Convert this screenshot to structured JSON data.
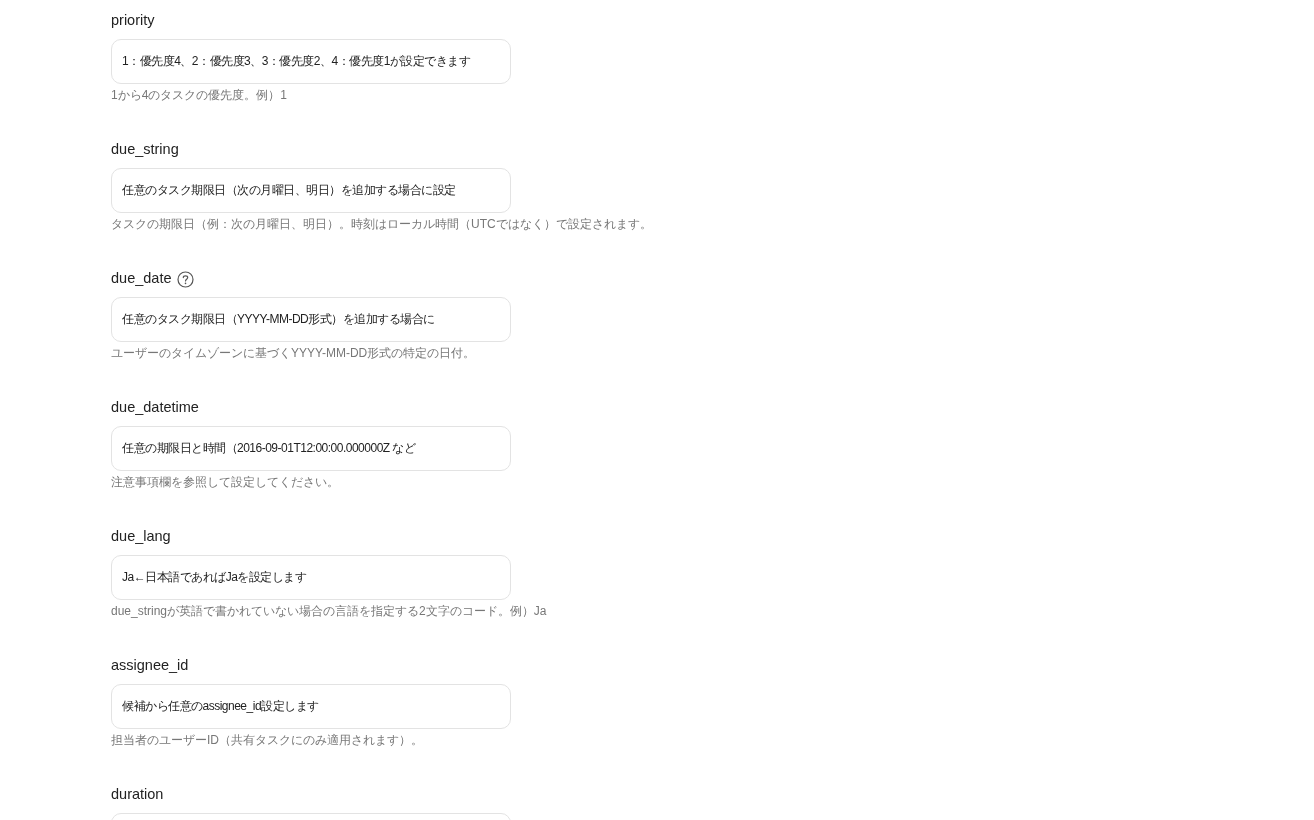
{
  "fields": [
    {
      "label": "priority",
      "help": false,
      "value": "1：優先度4、2：優先度3、3：優先度2、4：優先度1が設定できます",
      "hint": "1から4のタスクの優先度。例）1"
    },
    {
      "label": "due_string",
      "help": false,
      "value": "任意のタスク期限日（次の月曜日、明日）を追加する場合に設定",
      "hint": "タスクの期限日（例：次の月曜日、明日）。時刻はローカル時間（UTCではなく）で設定されます。"
    },
    {
      "label": "due_date",
      "help": true,
      "value": "任意のタスク期限日（YYYY-MM-DD形式）を追加する場合に",
      "hint": "ユーザーのタイムゾーンに基づくYYYY-MM-DD形式の特定の日付。"
    },
    {
      "label": "due_datetime",
      "help": false,
      "value": "任意の期限日と時間（2016-09-01T12:00:00.000000Z など",
      "hint": "注意事項欄を参照して設定してください。"
    },
    {
      "label": "due_lang",
      "help": false,
      "value": "Ja←日本語であればJaを設定します",
      "hint": "due_stringが英語で書かれていない場合の言語を指定する2文字のコード。例）Ja"
    },
    {
      "label": "assignee_id",
      "help": false,
      "value": "候補から任意のassignee_id設定します",
      "hint": "担当者のユーザーID（共有タスクにのみ適用されます）。"
    },
    {
      "label": "duration",
      "help": false
    }
  ]
}
